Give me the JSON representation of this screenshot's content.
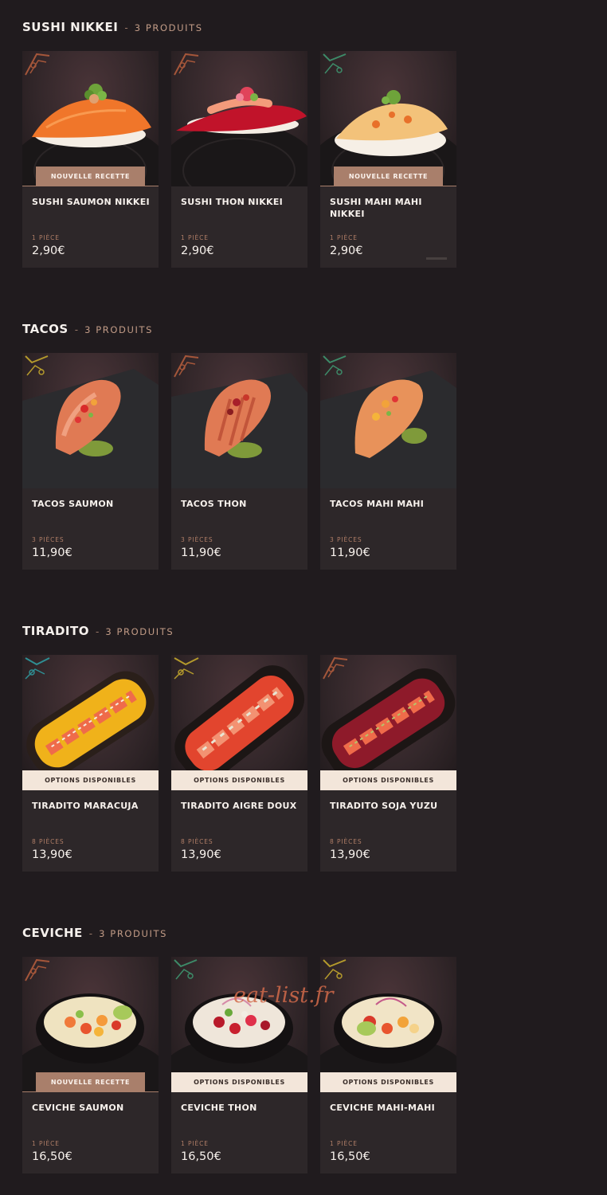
{
  "sections": [
    {
      "title": "SUSHI NIKKEI",
      "separator": "-",
      "count": "3 PRODUITS",
      "products": [
        {
          "name": "SUSHI SAUMON NIKKEI",
          "qty": "1 PIÈCE",
          "price": "2,90€",
          "badge": "NOUVELLE RECETTE",
          "badge_type": "new",
          "image": "salmon-nigiri",
          "deco_color": "#a4563a"
        },
        {
          "name": "SUSHI THON NIKKEI",
          "qty": "1 PIÈCE",
          "price": "2,90€",
          "badge": "",
          "badge_type": "",
          "image": "tuna-nigiri",
          "deco_color": "#a4563a"
        },
        {
          "name": "SUSHI MAHI MAHI NIKKEI",
          "qty": "1 PIÈCE",
          "price": "2,90€",
          "badge": "NOUVELLE RECETTE",
          "badge_type": "new",
          "image": "mahi-nigiri",
          "deco_color": "#3d8a68"
        }
      ]
    },
    {
      "title": "TACOS",
      "separator": "-",
      "count": "3 PRODUITS",
      "products": [
        {
          "name": "TACOS SAUMON",
          "qty": "3 PIÈCES",
          "price": "11,90€",
          "badge": "",
          "badge_type": "",
          "image": "salmon-taco",
          "deco_color": "#b49a2c"
        },
        {
          "name": "TACOS THON",
          "qty": "3 PIÈCES",
          "price": "11,90€",
          "badge": "",
          "badge_type": "",
          "image": "tuna-taco",
          "deco_color": "#a4563a"
        },
        {
          "name": "TACOS MAHI MAHI",
          "qty": "3 PIÈCES",
          "price": "11,90€",
          "badge": "",
          "badge_type": "",
          "image": "mahi-taco",
          "deco_color": "#3d8a68"
        }
      ]
    },
    {
      "title": "TIRADITO",
      "separator": "-",
      "count": "3 PRODUITS",
      "products": [
        {
          "name": "TIRADITO MARACUJA",
          "qty": "8 PIÈCES",
          "price": "13,90€",
          "badge": "OPTIONS DISPONIBLES",
          "badge_type": "opt",
          "image": "tiradito-yellow",
          "deco_color": "#2f8e93"
        },
        {
          "name": "TIRADITO AIGRE DOUX",
          "qty": "8 PIÈCES",
          "price": "13,90€",
          "badge": "OPTIONS DISPONIBLES",
          "badge_type": "opt",
          "image": "tiradito-red",
          "deco_color": "#b49a2c"
        },
        {
          "name": "TIRADITO SOJA YUZU",
          "qty": "8 PIÈCES",
          "price": "13,90€",
          "badge": "OPTIONS DISPONIBLES",
          "badge_type": "opt",
          "image": "tiradito-dark",
          "deco_color": "#a4563a"
        }
      ]
    },
    {
      "title": "CEVICHE",
      "separator": "-",
      "count": "3 PRODUITS",
      "products": [
        {
          "name": "CEVICHE SAUMON",
          "qty": "1 PIÈCE",
          "price": "16,50€",
          "badge": "NOUVELLE RECETTE",
          "badge_type": "new",
          "image": "ceviche-salmon",
          "deco_color": "#a4563a"
        },
        {
          "name": "CEVICHE THON",
          "qty": "1 PIÈCE",
          "price": "16,50€",
          "badge": "OPTIONS DISPONIBLES",
          "badge_type": "opt",
          "image": "ceviche-tuna",
          "deco_color": "#3d8a68"
        },
        {
          "name": "CEVICHE MAHI-MAHI",
          "qty": "1 PIÈCE",
          "price": "16,50€",
          "badge": "OPTIONS DISPONIBLES",
          "badge_type": "opt",
          "image": "ceviche-mahi",
          "deco_color": "#b49a2c"
        }
      ]
    }
  ],
  "watermark": "eat-list.fr",
  "colors": {
    "background": "#201b1e",
    "card": "#2d2729",
    "accent": "#a97f6b",
    "badge_light": "#f3e6da"
  }
}
